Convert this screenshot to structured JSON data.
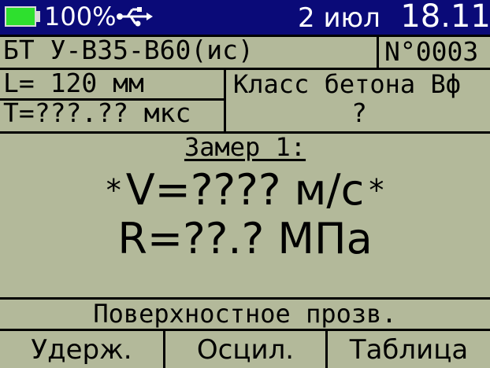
{
  "status": {
    "battery_percent": "100%",
    "battery_level": 1.0,
    "date": "2 июл",
    "time": "18.11"
  },
  "device": {
    "sensor": "БТ У-В35-В60(ис)",
    "number": "N°0003"
  },
  "params": {
    "length": "L= 120 мм",
    "time": "T=???.?? мкс",
    "class_label": "Класс бетона Вф",
    "class_value": "?"
  },
  "measurement": {
    "title": "Замер 1:",
    "velocity_marker_left": "*",
    "velocity": "V=???? м/с",
    "velocity_marker_right": "*",
    "strength": "R=??.? МПа"
  },
  "mode": "Поверхностное прозв.",
  "buttons": {
    "hold": "Удерж.",
    "oscil": "Осцил.",
    "table": "Таблица"
  },
  "colors": {
    "screen_bg": "#b3b99a",
    "title_bar": "#0a0a78",
    "battery": "#2ee02e"
  }
}
